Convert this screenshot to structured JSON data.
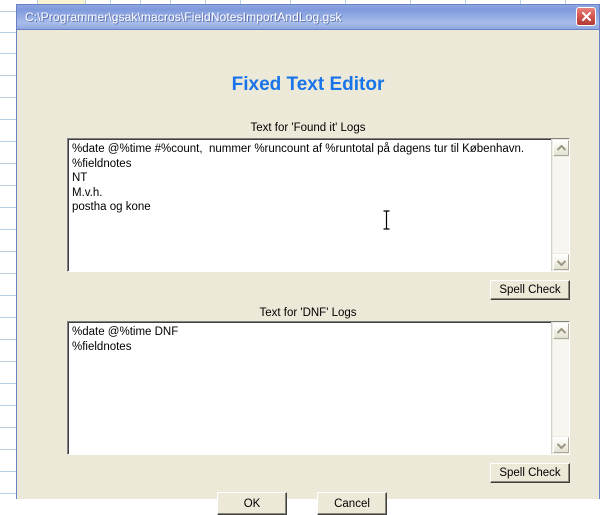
{
  "window": {
    "title": "C:\\Programmer\\gsak\\macros\\FieldNotesImportAndLog.gsk",
    "close_label": "✕",
    "title_bar_color": "#8fa7e0",
    "client_color": "#ece9d8",
    "border_color": "#6a7fc4"
  },
  "heading": {
    "text": "Fixed Text Editor",
    "color": "#1874e8"
  },
  "found_section": {
    "label": "Text for 'Found it' Logs",
    "value": "%date @%time #%count,  nummer %runcount af %runtotal på dagens tur til København.\n%fieldnotes\nNT\nM.v.h.\npostha og kone",
    "spell_check_label": "Spell Check"
  },
  "dnf_section": {
    "label": "Text for 'DNF' Logs",
    "value": "%date @%time DNF\n%fieldnotes",
    "spell_check_label": "Spell Check"
  },
  "footer": {
    "ok_label": "OK",
    "cancel_label": "Cancel"
  },
  "scrollbar": {
    "up_arrow": "scroll-up-arrow",
    "down_arrow": "scroll-down-arrow"
  }
}
